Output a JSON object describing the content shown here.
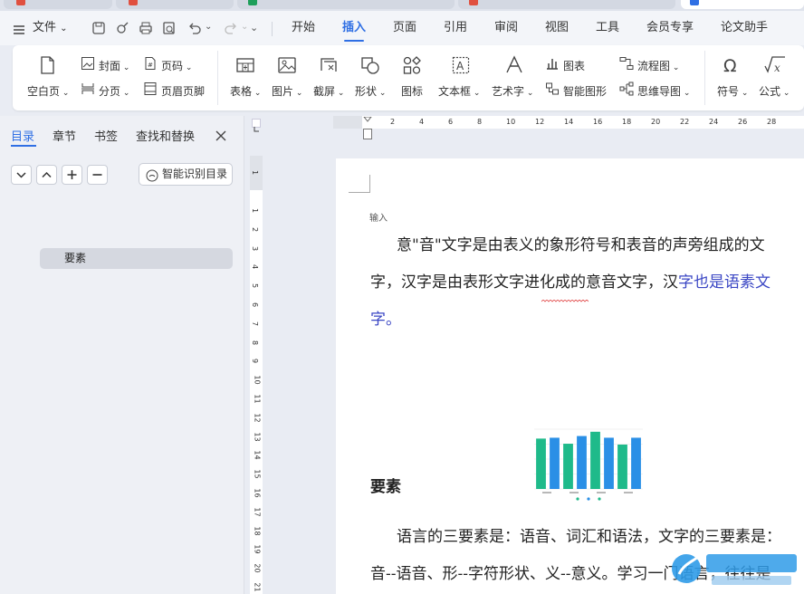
{
  "menubar": {
    "file_label": "文件",
    "tabs": [
      "开始",
      "插入",
      "页面",
      "引用",
      "审阅",
      "视图",
      "工具",
      "会员专享",
      "论文助手"
    ],
    "active_tab": "插入"
  },
  "ribbon": {
    "blank_page": "空白页",
    "cover": "封面",
    "page_break": "分页",
    "page_number": "页码",
    "header_footer": "页眉页脚",
    "table": "表格",
    "picture": "图片",
    "screenshot": "截屏",
    "shape": "形状",
    "icon": "图标",
    "textbox": "文本框",
    "wordart": "艺术字",
    "chart": "图表",
    "smart_graphic": "智能图形",
    "flowchart": "流程图",
    "mindmap": "思维导图",
    "symbol": "符号",
    "formula": "公式"
  },
  "panel": {
    "tabs": [
      "目录",
      "章节",
      "书签",
      "查找和替换"
    ],
    "smart_toc": "智能识别目录",
    "toc_item": "要素"
  },
  "ruler": {
    "h_ticks": [
      "2",
      "2",
      "4",
      "6",
      "8",
      "10",
      "12",
      "14",
      "16",
      "18",
      "20",
      "22",
      "24",
      "26",
      "28"
    ],
    "v_ticks": [
      "1",
      "1",
      "2",
      "3",
      "4",
      "5",
      "6",
      "7",
      "8",
      "9",
      "10",
      "11",
      "12",
      "13",
      "14",
      "15",
      "16",
      "17",
      "18",
      "19",
      "20",
      "21"
    ]
  },
  "document": {
    "input_hint": "输入",
    "para1_line1": "意\"音\"文字是由表义的象形符号和表音的声旁组成的文",
    "para1_line2_a": "字，汉字是由表形文字进化成的意音文字，汉",
    "para1_line2_b": "字也是语素文",
    "para1_line3": "字。",
    "heading": "要素",
    "para2_line1": "语言的三要素是：语音、词汇和语法，文字的三要素是：",
    "para2_line2": "音--语音、形--字符形状、义--意义。学习一门语言，往往是"
  },
  "chart_data": {
    "type": "bar",
    "categories": [
      "",
      "",
      "",
      "",
      "",
      "",
      "",
      ""
    ],
    "values": [
      59,
      60,
      53,
      62,
      67,
      60,
      52,
      60
    ],
    "colors": [
      "#1fba8a",
      "#2a8fe6",
      "#1fba8a",
      "#2a8fe6",
      "#1fba8a",
      "#2a8fe6",
      "#1fba8a",
      "#2a8fe6"
    ],
    "ylim": [
      0,
      70
    ],
    "grid": true,
    "legend_placement": "bottom"
  },
  "colors": {
    "accent": "#2f6fe4",
    "link_text": "#3a46c4"
  }
}
